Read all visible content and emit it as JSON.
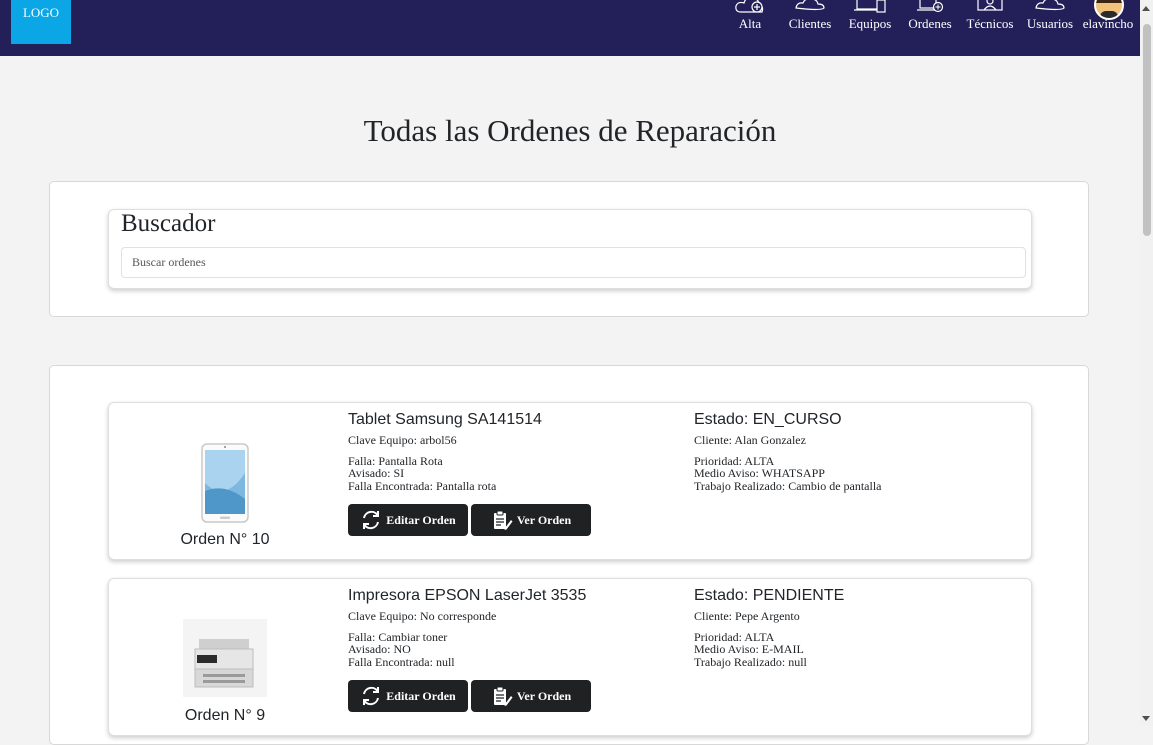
{
  "header": {
    "logo": "LOGO",
    "nav": [
      {
        "label": "Alta",
        "icon": "cloud-plus-icon"
      },
      {
        "label": "Clientes",
        "icon": "users-cloud-icon"
      },
      {
        "label": "Equipos",
        "icon": "devices-icon"
      },
      {
        "label": "Ordenes",
        "icon": "monitor-add-icon"
      },
      {
        "label": "Técnicos",
        "icon": "technician-icon"
      },
      {
        "label": "Usuarios",
        "icon": "users-icon"
      }
    ],
    "user": {
      "name": "elavincho",
      "icon": "avatar-icon"
    }
  },
  "main": {
    "title": "Todas las Ordenes de Reparación",
    "search": {
      "title": "Buscador",
      "placeholder": "Buscar ordenes",
      "value": ""
    },
    "orders": [
      {
        "number": "Orden N° 10",
        "image": "tablet-image",
        "equipo": "Tablet Samsung SA141514",
        "clave": "Clave Equipo: arbol56",
        "falla": "Falla: Pantalla Rota",
        "avisado": "Avisado: SI",
        "falla_encontrada": "Falla Encontrada: Pantalla rota",
        "estado": "Estado: EN_CURSO",
        "cliente": "Cliente: Alan Gonzalez",
        "prioridad": "Prioridad: ALTA",
        "medio_aviso": "Medio Aviso: WHATSAPP",
        "trabajo": "Trabajo Realizado: Cambio de pantalla",
        "edit_label": "Editar Orden",
        "view_label": "Ver Orden"
      },
      {
        "number": "Orden N° 9",
        "image": "printer-image",
        "equipo": "Impresora EPSON LaserJet 3535",
        "clave": "Clave Equipo: No corresponde",
        "falla": "Falla: Cambiar toner",
        "avisado": "Avisado: NO",
        "falla_encontrada": "Falla Encontrada: null",
        "estado": "Estado: PENDIENTE",
        "cliente": "Cliente: Pepe Argento",
        "prioridad": "Prioridad: ALTA",
        "medio_aviso": "Medio Aviso: E-MAIL",
        "trabajo": "Trabajo Realizado: null",
        "edit_label": "Editar Orden",
        "view_label": "Ver Orden"
      }
    ]
  },
  "colors": {
    "navbar": "#232059",
    "logo": "#0aa6e6",
    "button": "#1f2123",
    "background": "#f3f3f3"
  }
}
